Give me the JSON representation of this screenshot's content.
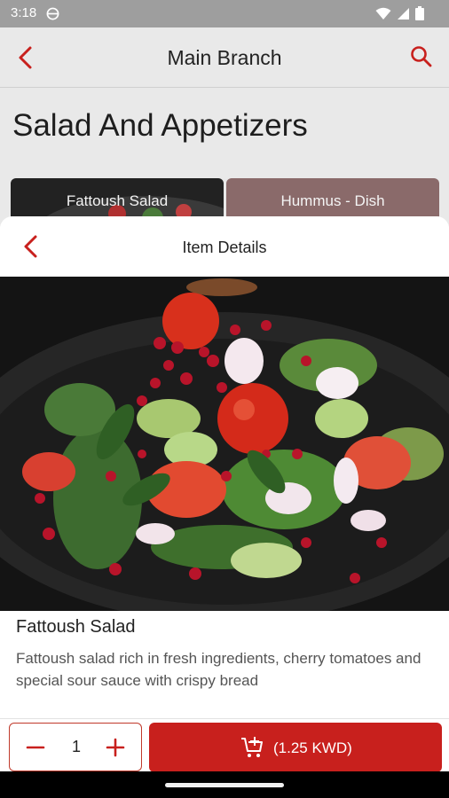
{
  "status_bar": {
    "time": "3:18",
    "icons": [
      "vpn-icon",
      "wifi-icon",
      "signal-icon",
      "battery-icon"
    ]
  },
  "background_page": {
    "title": "Main Branch",
    "category_title": "Salad And Appetizers",
    "cards": [
      {
        "label": "Fattoush Salad"
      },
      {
        "label": "Hummus - Dish"
      }
    ]
  },
  "sheet": {
    "title": "Item Details",
    "item_name": "Fattoush Salad",
    "item_description": "Fattoush salad rich in fresh ingredients, cherry tomatoes and special sour sauce with crispy bread",
    "quantity": "1",
    "add_button_label": "(1.25 KWD)"
  },
  "colors": {
    "accent": "#c8201d",
    "status_bar": "#9e9e9e",
    "background": "#e9e9e9"
  }
}
